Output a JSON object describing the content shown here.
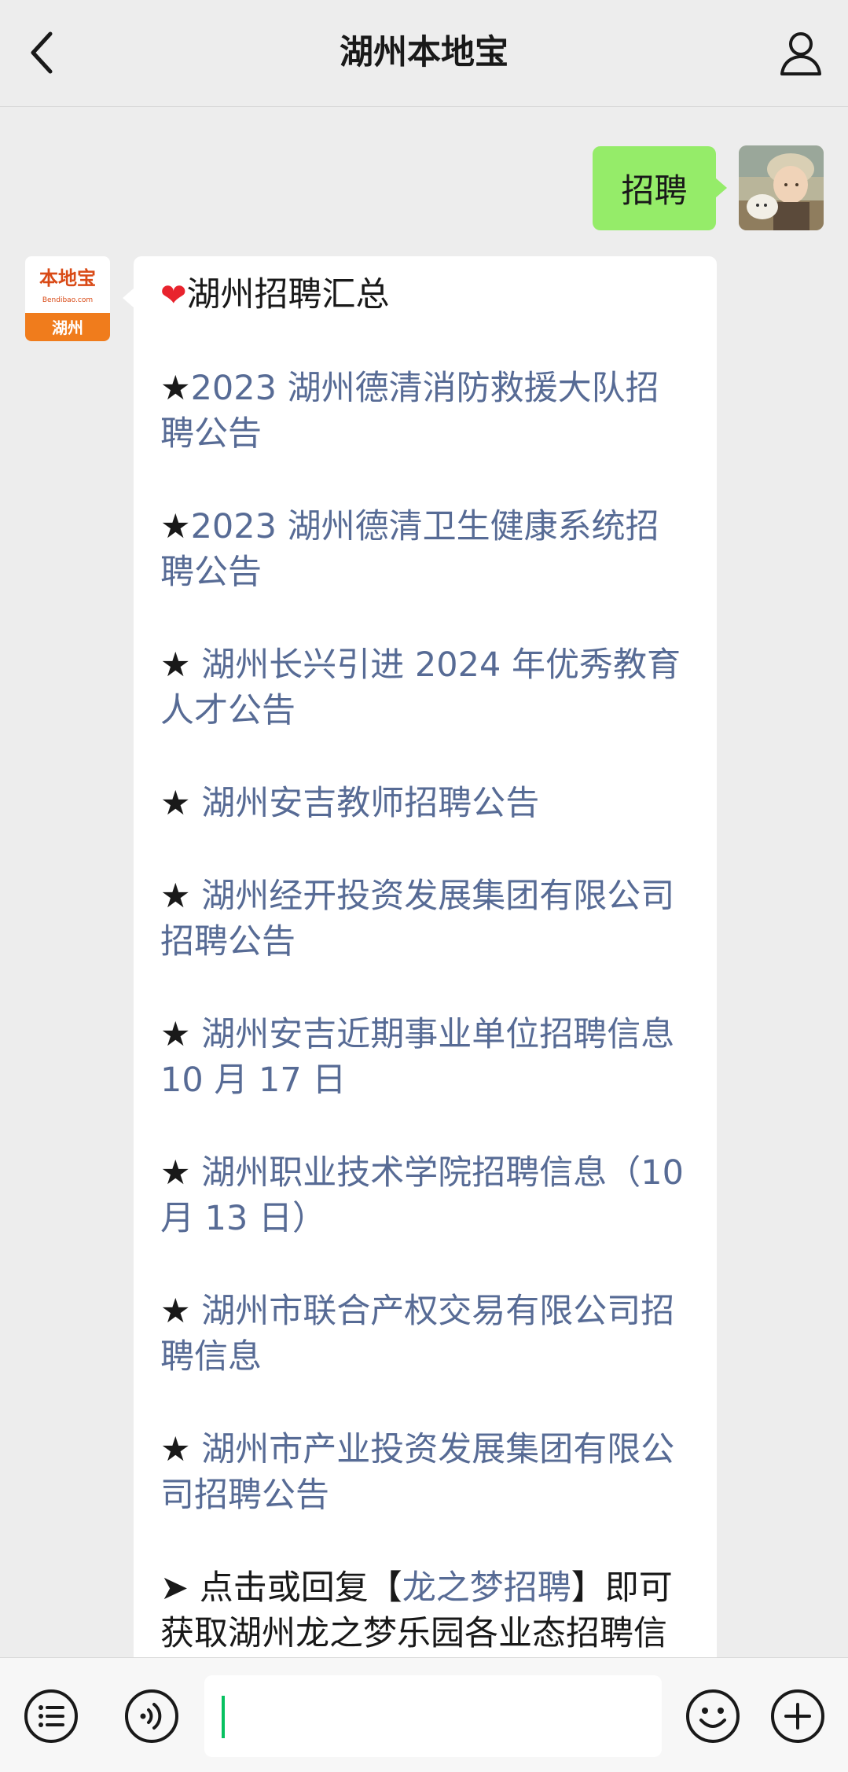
{
  "nav": {
    "title": "湖州本地宝",
    "back_icon": "chevron-left-icon",
    "profile_icon": "person-icon"
  },
  "outgoing_message": {
    "text": "招聘"
  },
  "brand_avatar": {
    "top_text": "本地宝",
    "domain_text": "Bendibao.com",
    "city_text": "湖州",
    "colors": {
      "top": "#ffffff",
      "bottom": "#f07c1c",
      "brand": "#d94a16"
    }
  },
  "incoming_message": {
    "header": "湖州招聘汇总",
    "header_icon": "heart",
    "items": [
      {
        "bullet": "★",
        "text": "2023 湖州德清消防救援大队招聘公告"
      },
      {
        "bullet": "★",
        "text": "2023 湖州德清卫生健康系统招聘公告"
      },
      {
        "bullet": "★",
        "text": " 湖州长兴引进 2024 年优秀教育人才公告"
      },
      {
        "bullet": "★",
        "text": " 湖州安吉教师招聘公告"
      },
      {
        "bullet": "★",
        "text": " 湖州经开投资发展集团有限公司招聘公告"
      },
      {
        "bullet": "★",
        "text": " 湖州安吉近期事业单位招聘信息 10 月 17 日"
      },
      {
        "bullet": "★",
        "text": " 湖州职业技术学院招聘信息（10 月 13 日）"
      },
      {
        "bullet": "★",
        "text": " 湖州市联合产权交易有限公司招聘信息"
      },
      {
        "bullet": "★",
        "text": " 湖州市产业投资发展集团有限公司招聘公告"
      }
    ],
    "footer": {
      "arrow": "➤",
      "prefix": " 点击或回复【",
      "keyword": "龙之梦招聘",
      "suffix": "】即可获取湖州龙之梦乐园各业态招聘信"
    }
  },
  "input_bar": {
    "input_value": "",
    "icons": [
      "list-icon",
      "voice-icon",
      "emoji-icon",
      "plus-icon"
    ]
  },
  "colors": {
    "background": "#ededed",
    "outgoing_bubble": "#95ec69",
    "incoming_bubble": "#ffffff",
    "link": "#576b95",
    "caret": "#07c160"
  }
}
